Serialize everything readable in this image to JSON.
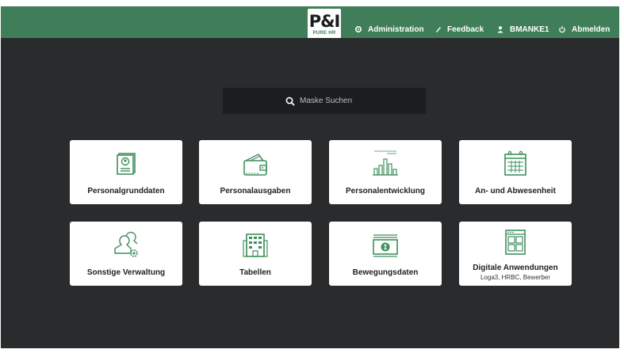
{
  "header": {
    "logo_text": "P&I",
    "logo_subtext": "PURE HR",
    "nav": {
      "administration": "Administration",
      "feedback": "Feedback",
      "user": "BMANKE1",
      "logout": "Abmelden"
    }
  },
  "search": {
    "placeholder": "Maske Suchen",
    "icon": "search-icon"
  },
  "tiles": [
    {
      "label": "Personalgrunddaten",
      "icon": "personal-file-icon"
    },
    {
      "label": "Personalausgaben",
      "icon": "wallet-icon"
    },
    {
      "label": "Personalentwicklung",
      "icon": "bar-chart-icon"
    },
    {
      "label": "An- und Abwesenheit",
      "icon": "calendar-icon"
    },
    {
      "label": "Sonstige Verwaltung",
      "icon": "users-gear-icon"
    },
    {
      "label": "Tabellen",
      "icon": "building-icon"
    },
    {
      "label": "Bewegungsdaten",
      "icon": "money-icon"
    },
    {
      "label": "Digitale Anwendungen",
      "sublabel": "Loga3, HRBC, Bewerber",
      "icon": "app-window-icon"
    }
  ],
  "colors": {
    "header_bg": "#3f7e58",
    "main_bg": "#2a2b2d",
    "search_bg": "#1c1d1f",
    "icon_green": "#3f8f5c",
    "tile_bg": "#ffffff"
  }
}
